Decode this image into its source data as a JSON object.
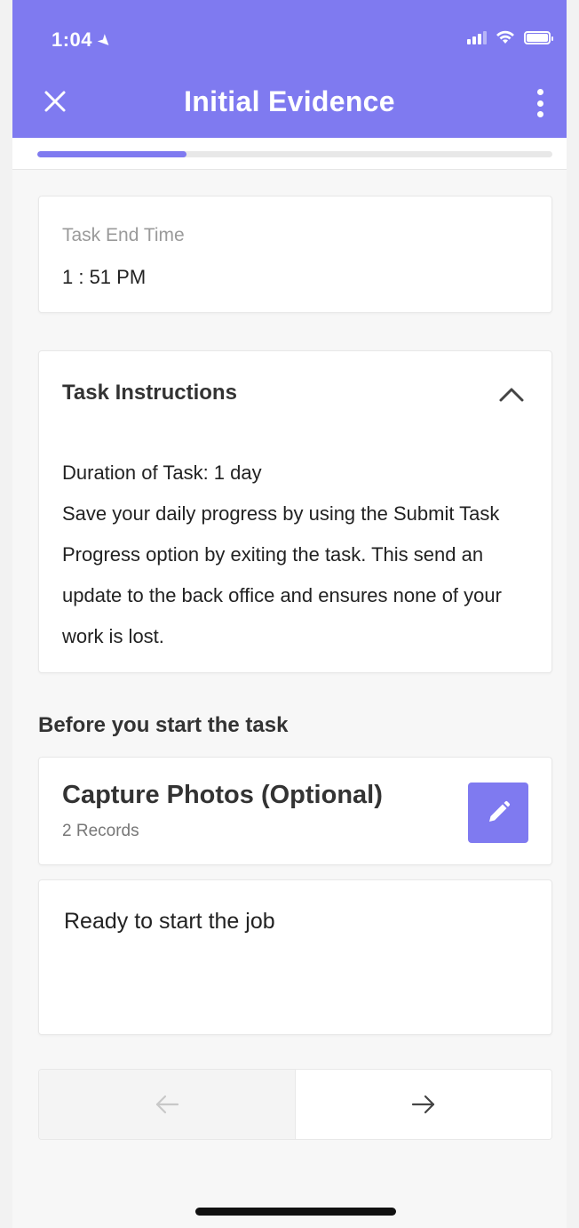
{
  "status_bar": {
    "time": "1:04"
  },
  "header": {
    "title": "Initial Evidence",
    "close_icon": "close-icon",
    "more_icon": "more-vertical-icon"
  },
  "progress": {
    "value": 0.29
  },
  "end_time": {
    "label": "Task End Time",
    "value": "1 : 51 PM"
  },
  "instructions": {
    "title": "Task Instructions",
    "lines": [
      "Duration of Task: 1 day",
      "Save your daily progress by using the Submit Task Progress option by exiting the task. This send an update to the back office and ensures none of your work is lost."
    ]
  },
  "section_heading": "Before you start the task",
  "capture_photos": {
    "title": "Capture Photos (Optional)",
    "subtitle": "2 Records",
    "edit_icon": "pencil-icon"
  },
  "ready": {
    "text": "Ready to start the job"
  },
  "navigation": {
    "prev_icon": "arrow-left-icon",
    "next_icon": "arrow-right-icon"
  },
  "colors": {
    "accent": "#7f7af0",
    "background": "#f7f7f7",
    "card": "#ffffff"
  }
}
